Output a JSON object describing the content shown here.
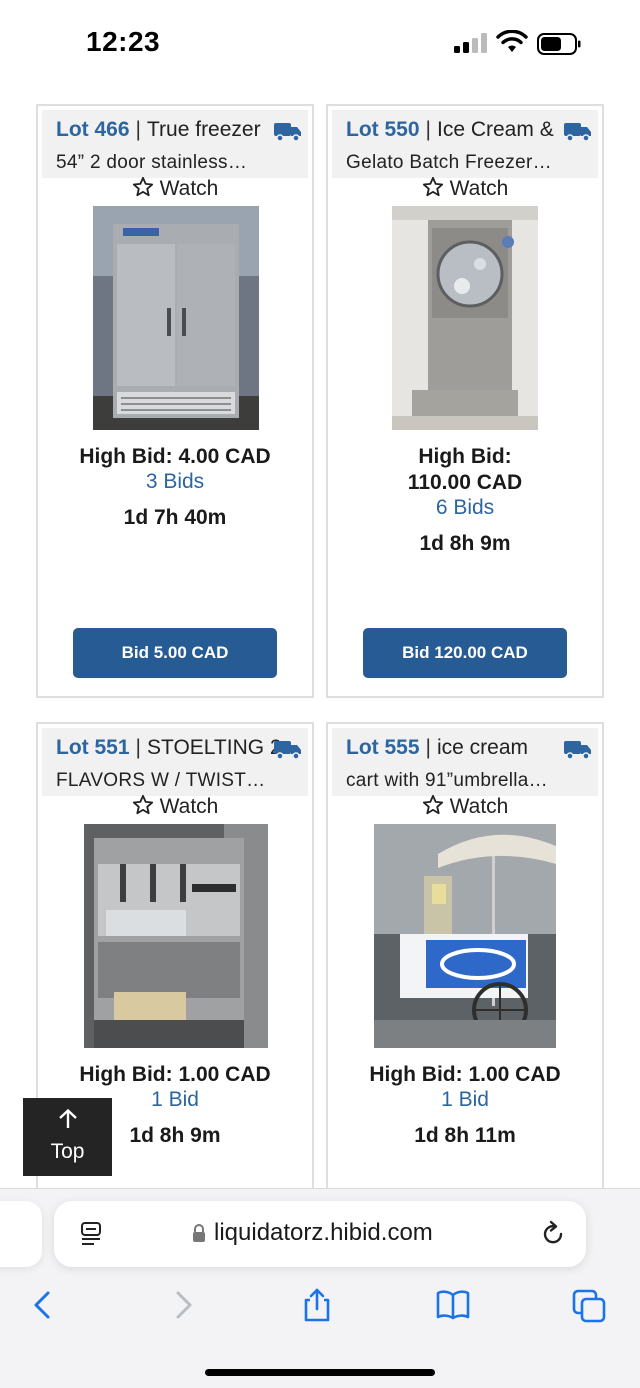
{
  "status_bar": {
    "time": "12:23"
  },
  "lots": [
    {
      "lot": "Lot 466",
      "title1": "True freezer",
      "title2": "54” 2 door stainless…",
      "watch": "Watch",
      "high_bid": "High Bid: 4.00 CAD",
      "bids": "3 Bids",
      "time_left": "1d 7h 40m",
      "button": "Bid 5.00 CAD"
    },
    {
      "lot": "Lot 550",
      "title1": "Ice Cream &",
      "title2": "Gelato Batch Freezer…",
      "watch": "Watch",
      "high_bid": "High Bid: 110.00 CAD",
      "bids": "6 Bids",
      "time_left": "1d 8h 9m",
      "button": "Bid 120.00 CAD"
    },
    {
      "lot": "Lot 551",
      "title1": "STOELTING 2",
      "title2": "FLAVORS W / TWIST…",
      "watch": "Watch",
      "high_bid": "High Bid: 1.00 CAD",
      "bids": "1 Bid",
      "time_left": "1d 8h 9m",
      "button": ""
    },
    {
      "lot": "Lot 555",
      "title1": "ice cream",
      "title2": "cart with 91”umbrella…",
      "watch": "Watch",
      "high_bid": "High Bid: 1.00 CAD",
      "bids": "1 Bid",
      "time_left": "1d 8h 11m",
      "button": ""
    }
  ],
  "top_button": {
    "label": "Top"
  },
  "browser": {
    "url": "liquidatorz.hibid.com"
  },
  "icons": {
    "truck": "truck-icon",
    "watch": "star-outline-icon",
    "reader": "reader-mode-icon",
    "lock": "lock-icon",
    "reload": "reload-icon",
    "back": "chevron-left-icon",
    "forward": "chevron-right-icon",
    "share": "share-icon",
    "bookmarks": "book-icon",
    "tabs": "tabs-icon"
  },
  "colors": {
    "accent": "#2c65a0",
    "button": "#265b93"
  }
}
